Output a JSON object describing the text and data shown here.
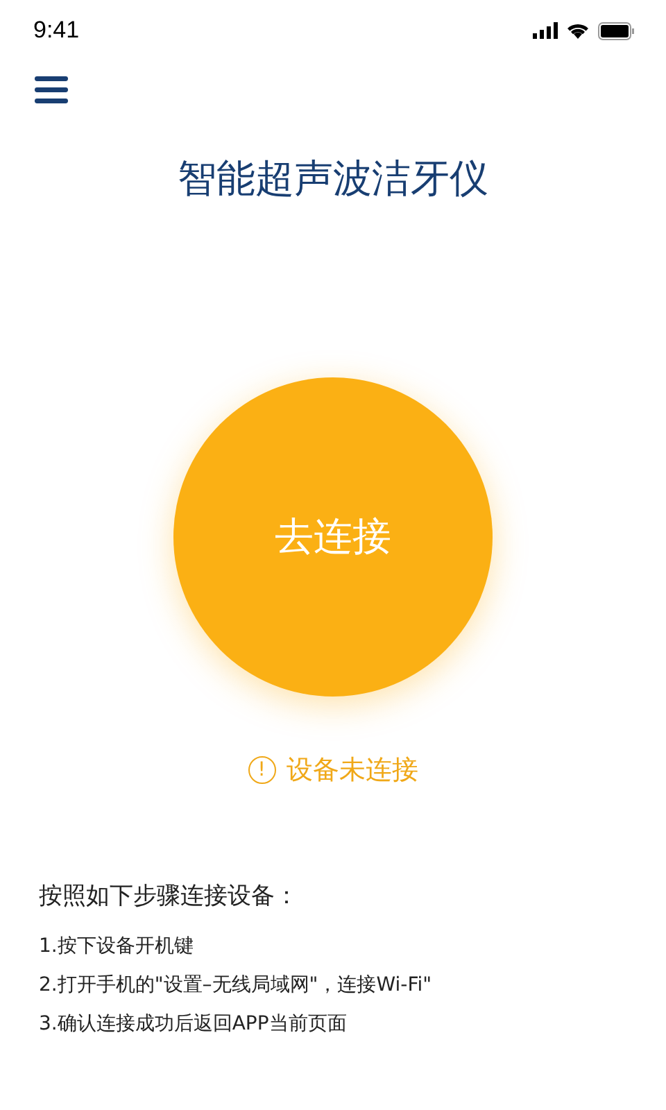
{
  "status_bar": {
    "time": "9:41"
  },
  "title": "智能超声波洁牙仪",
  "connect_button": "去连接",
  "status": {
    "text": "设备未连接",
    "icon": "!"
  },
  "instructions": {
    "heading": "按照如下步骤连接设备：",
    "steps": [
      "1.按下设备开机键",
      "2.打开手机的\"设置–无线局域网\"，连接Wi-Fi\"",
      "3.确认连接成功后返回APP当前页面"
    ]
  }
}
